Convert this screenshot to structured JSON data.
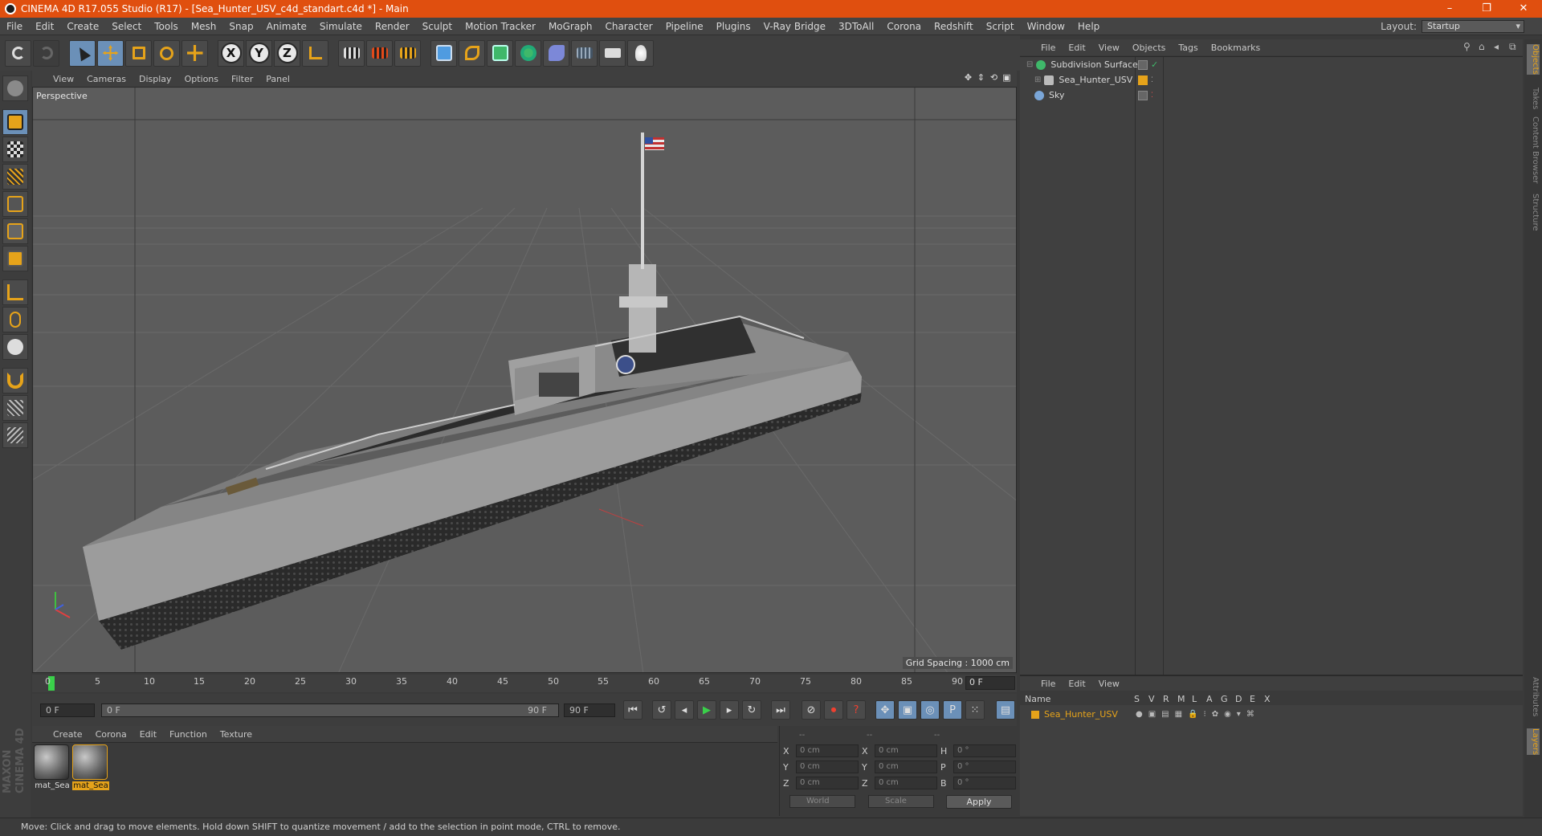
{
  "window": {
    "title": "CINEMA 4D R17.055 Studio (R17) - [Sea_Hunter_USV_c4d_standart.c4d *] - Main",
    "minimize": "–",
    "restore": "❐",
    "close": "✕"
  },
  "menubar": {
    "items": [
      "File",
      "Edit",
      "Create",
      "Select",
      "Tools",
      "Mesh",
      "Snap",
      "Animate",
      "Simulate",
      "Render",
      "Sculpt",
      "Motion Tracker",
      "MoGraph",
      "Character",
      "Pipeline",
      "Plugins",
      "V-Ray Bridge",
      "3DToAll",
      "Corona",
      "Redshift",
      "Script",
      "Window",
      "Help"
    ],
    "layout_label": "Layout:",
    "layout_value": "Startup"
  },
  "toolbar": {
    "axis_x": "X",
    "axis_y": "Y",
    "axis_z": "Z"
  },
  "viewport": {
    "menu": [
      "View",
      "Cameras",
      "Display",
      "Options",
      "Filter",
      "Panel"
    ],
    "label": "Perspective",
    "grid_spacing": "Grid Spacing : 1000 cm"
  },
  "timeline": {
    "ticks": [
      "0",
      "5",
      "10",
      "15",
      "20",
      "25",
      "30",
      "35",
      "40",
      "45",
      "50",
      "55",
      "60",
      "65",
      "70",
      "75",
      "80",
      "85",
      "90"
    ],
    "frame_end": "0 F"
  },
  "transport": {
    "current_frame": "0 F",
    "range_start": "0 F",
    "range_end": "90 F",
    "max_frame": "90 F"
  },
  "material_manager": {
    "menu": [
      "Create",
      "Corona",
      "Edit",
      "Function",
      "Texture"
    ],
    "materials": [
      {
        "name": "mat_Sea",
        "selected": false
      },
      {
        "name": "mat_Sea",
        "selected": true
      }
    ]
  },
  "coordinates": {
    "headers": [
      "--",
      "--",
      "--"
    ],
    "rows": [
      {
        "a": "X",
        "av": "0 cm",
        "b": "X",
        "bv": "0 cm",
        "c": "H",
        "cv": "0 °"
      },
      {
        "a": "Y",
        "av": "0 cm",
        "b": "Y",
        "bv": "0 cm",
        "c": "P",
        "cv": "0 °"
      },
      {
        "a": "Z",
        "av": "0 cm",
        "b": "Z",
        "bv": "0 cm",
        "c": "B",
        "cv": "0 °"
      }
    ],
    "mode_world": "World",
    "mode_scale": "Scale",
    "apply": "Apply"
  },
  "object_manager": {
    "menu": [
      "File",
      "Edit",
      "View",
      "Objects",
      "Tags",
      "Bookmarks"
    ],
    "objects": [
      {
        "name": "Subdivision Surface",
        "color": "#3fb86a"
      },
      {
        "name": "Sea_Hunter_USV",
        "color": "#bbbbbb"
      },
      {
        "name": "Sky",
        "color": "#7aa6d8"
      }
    ]
  },
  "layer_manager": {
    "menu": [
      "File",
      "Edit",
      "View"
    ],
    "columns": [
      "Name",
      "S",
      "V",
      "R",
      "M",
      "L",
      "A",
      "G",
      "D",
      "E",
      "X"
    ],
    "layers": [
      {
        "name": "Sea_Hunter_USV",
        "color": "#e6a31a"
      }
    ]
  },
  "right_tabs": [
    "Objects",
    "Takes",
    "Content Browser",
    "Structure",
    "Attributes",
    "Layers"
  ],
  "status": "Move: Click and drag to move elements. Hold down SHIFT to quantize movement / add to the selection in point mode, CTRL to remove.",
  "branding": "MAXON CINEMA 4D"
}
